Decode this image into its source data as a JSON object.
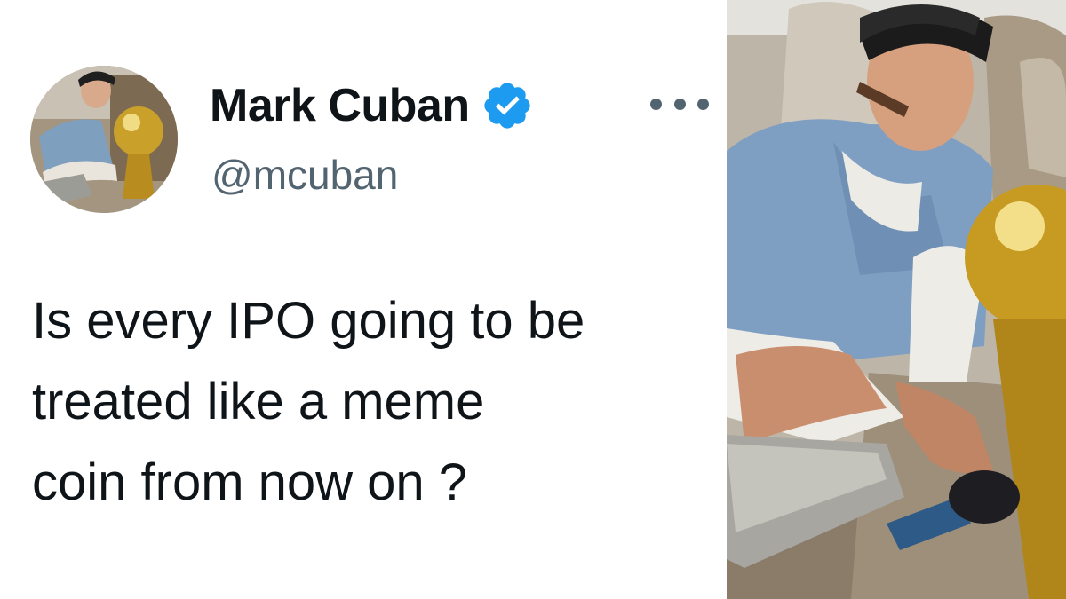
{
  "tweet": {
    "display_name": "Mark Cuban",
    "handle": "@mcuban",
    "verified": true,
    "text_lines": [
      "Is every IPO going to be",
      "treated like a meme",
      "coin from now on ?"
    ]
  },
  "icons": {
    "verified": "verified-badge-icon",
    "more": "more-options-icon"
  },
  "colors": {
    "background": "#ffffff",
    "text_primary": "#0f1419",
    "text_secondary": "#536471",
    "verified_blue": "#1d9bf0"
  }
}
